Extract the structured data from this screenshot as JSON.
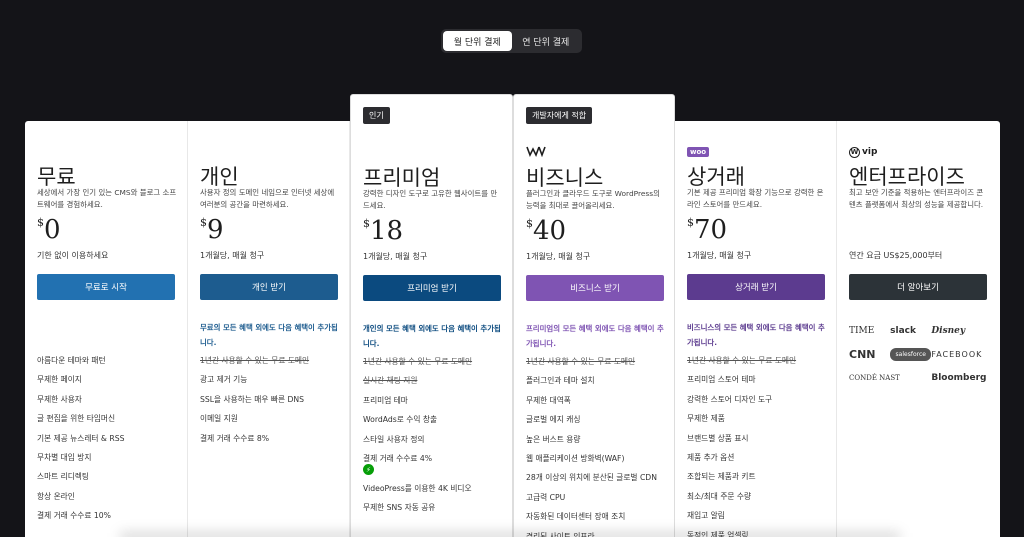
{
  "toggle": {
    "monthly": "월 단위 결제",
    "yearly": "연 단위 결제"
  },
  "colors": {
    "free": "#2271b1",
    "personal": "#1d5c8f",
    "premium": "#0b4a7f",
    "business": "#7f54b3",
    "commerce": "#5c3b8f",
    "enterprise": "#2c3338"
  },
  "plans": [
    {
      "title": "무료",
      "desc": "세상에서 가장 인기 있는 CMS와 블로그 소프트웨어를 경험하세요.",
      "currency": "$",
      "price": "0",
      "period": "기한 없이 이용하세요",
      "cta": "무료로 시작",
      "intro": "",
      "features": [
        "아름다운 테마와 패턴",
        "무제한 페이지",
        "무제한 사용자",
        "글 편집을 위한 타임머신",
        "기본 제공 뉴스레터 & RSS",
        "무차별 대입 방지",
        "스마트 리디렉팅",
        "항상 온라인",
        "결제 거래 수수료 10%"
      ]
    },
    {
      "title": "개인",
      "desc": "사용자 정의 도메인 네임으로 인터넷 세상에 여러분의 공간을 마련하세요.",
      "currency": "$",
      "price": "9",
      "period": "1개월당, 매월 청구",
      "cta": "개인 받기",
      "intro": "무료의 모든 혜택 외에도 다음 혜택이 추가됩니다.",
      "features": [
        "1년간 사용할 수 있는 무료 도메인",
        "광고 제거 기능",
        "SSL을 사용하는 매우 빠른 DNS",
        "이메일 지원",
        "결제 거래 수수료 8%"
      ]
    },
    {
      "title": "프리미엄",
      "badge": "인기",
      "desc": "강력한 디자인 도구로 고유한 웹사이트를 만드세요.",
      "currency": "$",
      "price": "18",
      "period": "1개월당, 매월 청구",
      "cta": "프리미엄 받기",
      "intro": "개인의 모든 혜택 외에도 다음 혜택이 추가됩니다.",
      "features": [
        "1년간 사용할 수 있는 무료 도메인",
        "실시간 채팅 지원",
        "프리미엄 테마",
        "WordAds로 수익 창출",
        "스타일 사용자 정의",
        "결제 거래 수수료 4%"
      ],
      "extra": [
        "VideoPress를 이용한 4K 비디오",
        "무제한 SNS 자동 공유"
      ]
    },
    {
      "title": "비즈니스",
      "badge": "개발자에게 적합",
      "logo": "woo-logo",
      "desc": "플러그인과 클라우드 도구로 WordPress의 능력을 최대로 끌어올리세요.",
      "currency": "$",
      "price": "40",
      "period": "1개월당, 매월 청구",
      "cta": "비즈니스 받기",
      "intro": "프리미엄의 모든 혜택 외에도 다음 혜택이 추가됩니다.",
      "features": [
        "1년간 사용할 수 있는 무료 도메인",
        "플러그인과 테마 설치",
        "무제한 대역폭",
        "글로벌 에지 캐싱",
        "높은 버스트 용량",
        "웹 애플리케이션 방화벽(WAF)",
        "28개 이상의 위치에 분산된 글로벌 CDN",
        "고급력 CPU",
        "자동화된 데이터센터 장애 조치",
        "격리된 사이트 인프라"
      ]
    },
    {
      "title": "상거래",
      "logo": "woo",
      "desc": "기본 제공 프리미엄 확장 기능으로 강력한 온라인 스토어를 만드세요.",
      "currency": "$",
      "price": "70",
      "period": "1개월당, 매월 청구",
      "cta": "상거래 받기",
      "intro": "비즈니스의 모든 혜택 외에도 다음 혜택이 추가됩니다.",
      "features": [
        "1년간 사용할 수 있는 무료 도메인",
        "프리미엄 스토어 테마",
        "강력한 스토어 디자인 도구",
        "무제한 제품",
        "브랜드별 상품 표시",
        "제품 추가 옵션",
        "조합되는 제품과 키트",
        "최소/최대 주문 수량",
        "재입고 알림",
        "동적인 제품 업셀링"
      ]
    },
    {
      "title": "엔터프라이즈",
      "logo": "vip",
      "desc": "최고 보안 기준을 적용하는 엔터프라이즈 콘텐츠 플랫폼에서 최상의 성능을 제공합니다.",
      "period": "연간 요금 US$25,000부터",
      "cta": "더 알아보기",
      "brands": [
        "TIME",
        "slack",
        "Disney",
        "CNN",
        "salesforce",
        "FACEBOOK",
        "CONDÉ NAST",
        "Bloomberg"
      ]
    }
  ]
}
